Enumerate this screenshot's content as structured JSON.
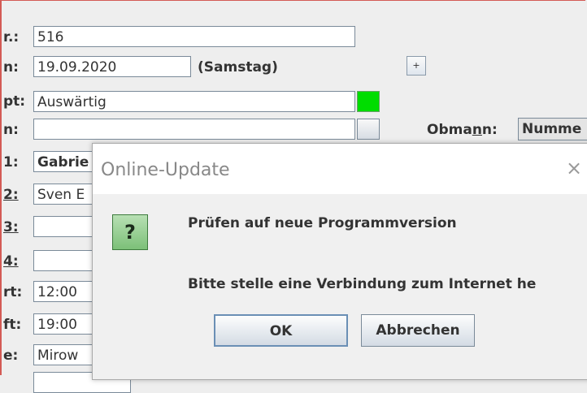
{
  "form": {
    "rows": [
      {
        "label": "r.:",
        "value": "516"
      },
      {
        "label": "n:",
        "value": "19.09.2020"
      },
      {
        "label": "pt:",
        "value": "Auswärtig"
      },
      {
        "label": "n:",
        "value": ""
      },
      {
        "label": "1:",
        "value": "Gabrie"
      },
      {
        "label": "2:",
        "value": "Sven E"
      },
      {
        "label": "3:",
        "value": ""
      },
      {
        "label": "4:",
        "value": ""
      },
      {
        "label": "rt:",
        "value": "12:00"
      },
      {
        "label": "ft:",
        "value": "19:00"
      },
      {
        "label": "e:",
        "value": "Mirow"
      }
    ],
    "weekday": "(Samstag)",
    "plus_label": "+",
    "obmann_label_pre": "Obma",
    "obmann_label_u": "n",
    "obmann_label_post": "n:",
    "obmann_value": "Numme",
    "status_color": "#00dd00"
  },
  "dialog": {
    "title": "Online-Update",
    "close_glyph": "×",
    "icon_glyph": "?",
    "message_line1": "Prüfen auf neue Programmversion",
    "message_line2": "Bitte stelle eine Verbindung zum Internet he",
    "ok_label": "OK",
    "cancel_label": "Abbrechen"
  }
}
